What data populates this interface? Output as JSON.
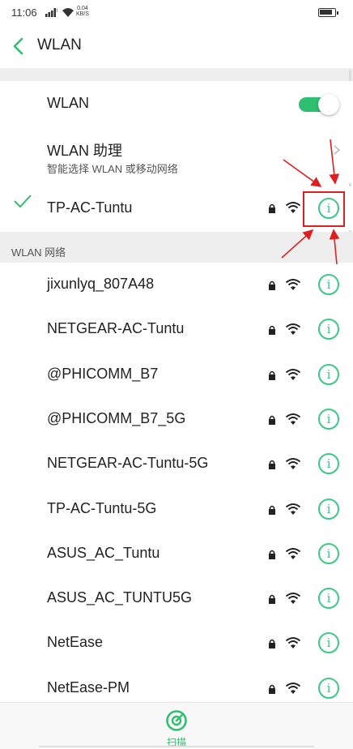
{
  "status_bar": {
    "time": "11:06",
    "speed_value": "0.04",
    "speed_unit": "KB/S"
  },
  "header": {
    "title": "WLAN"
  },
  "wlan_toggle": {
    "label": "WLAN",
    "enabled": true
  },
  "assistant": {
    "title": "WLAN 助理",
    "subtitle": "智能选择 WLAN 或移动网络"
  },
  "connected": {
    "ssid": "TP-AC-Tuntu"
  },
  "section": {
    "title": "WLAN 网络"
  },
  "networks": [
    {
      "ssid": "jixunlyq_807A48"
    },
    {
      "ssid": "NETGEAR-AC-Tuntu"
    },
    {
      "ssid": "@PHICOMM_B7"
    },
    {
      "ssid": "@PHICOMM_B7_5G"
    },
    {
      "ssid": "NETGEAR-AC-Tuntu-5G"
    },
    {
      "ssid": "TP-AC-Tuntu-5G"
    },
    {
      "ssid": "ASUS_AC_Tuntu"
    },
    {
      "ssid": "ASUS_AC_TUNTU5G"
    },
    {
      "ssid": "NetEase"
    },
    {
      "ssid": "NetEase-PM"
    }
  ],
  "bottom": {
    "scan_label": "扫描"
  },
  "icons": {
    "info": "i"
  },
  "colors": {
    "accent": "#2fbf71",
    "info": "#3dc887",
    "annotation": "#e02020"
  }
}
